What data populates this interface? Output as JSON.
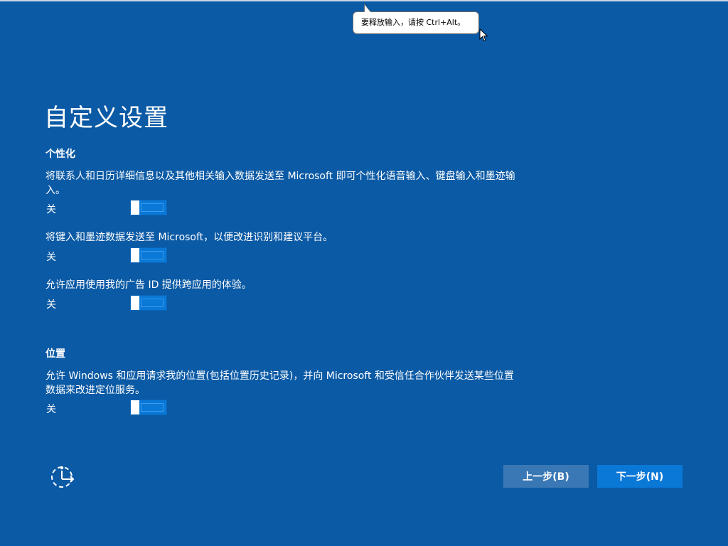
{
  "tooltip": {
    "text": "要释放输入，请按 Ctrl+Alt。"
  },
  "page": {
    "title": "自定义设置"
  },
  "personalization": {
    "heading": "个性化",
    "items": [
      {
        "description": "将联系人和日历详细信息以及其他相关输入数据发送至 Microsoft 即可个性化语音输入、键盘输入和墨迹输入。",
        "state_label": "关",
        "on": false
      },
      {
        "description": "将键入和墨迹数据发送至 Microsoft，以便改进识别和建议平台。",
        "state_label": "关",
        "on": false
      },
      {
        "description": "允许应用使用我的广告 ID 提供跨应用的体验。",
        "state_label": "关",
        "on": false
      }
    ]
  },
  "location": {
    "heading": "位置",
    "items": [
      {
        "description": "允许 Windows 和应用请求我的位置(包括位置历史记录)，并向 Microsoft 和受信任合作伙伴发送某些位置数据来改进定位服务。",
        "state_label": "关",
        "on": false
      }
    ]
  },
  "footer": {
    "ease_of_access_icon": "ease-of-access-icon",
    "back_label": "上一步(B)",
    "next_label": "下一步(N)"
  },
  "colors": {
    "background": "#0b5aa5",
    "accent": "#0a78d7",
    "back_button": "#3a78b5"
  }
}
